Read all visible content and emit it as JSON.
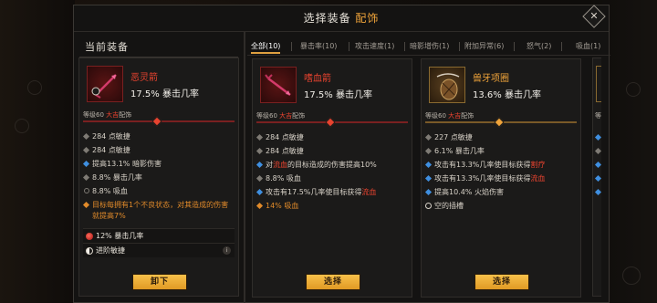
{
  "title": {
    "prefix": "选择装备 ",
    "accent": "配饰"
  },
  "current_column": {
    "title": "当前装备"
  },
  "tabs": [
    {
      "label": "全部(10)",
      "active": true
    },
    {
      "label": "暴击率(10)",
      "active": false
    },
    {
      "label": "攻击速度(1)",
      "active": false
    },
    {
      "label": "暗影增伤(1)",
      "active": false
    },
    {
      "label": "附加异常(6)",
      "active": false
    },
    {
      "label": "怒气(2)",
      "active": false
    },
    {
      "label": "吸血(1)",
      "active": false
    }
  ],
  "current_item": {
    "name": "恶灵箭",
    "main_stat": "17.5% 暴击几率",
    "level_prefix": "等级60 ",
    "quality": "大吉",
    "slot": "配饰",
    "stats": [
      {
        "text": "284 点敏捷"
      },
      {
        "text": "284 点敏捷"
      },
      {
        "text": "提高13.1% 暗影伤害"
      },
      {
        "text": "8.8% 暴击几率"
      },
      {
        "text": "8.8% 吸血"
      },
      {
        "text": "目标每拥有1个不良状态，对其造成的伤害就提高7%"
      }
    ],
    "gem": "12% 暴击几率",
    "advanced": "进阶敏捷",
    "info": "i",
    "button": "卸下"
  },
  "cards": [
    {
      "name": "嗜血箭",
      "main_stat": "17.5% 暴击几率",
      "level_prefix": "等级60 ",
      "quality": "大吉",
      "slot": "配饰",
      "stats": [
        {
          "text": "284 点敏捷"
        },
        {
          "text": "284 点敏捷"
        },
        {
          "pre": "对",
          "hl": "流血",
          "post": "的目标造成的伤害提高10%"
        },
        {
          "text": "8.8% 吸血"
        },
        {
          "pre": "攻击有17.5%几率使目标获得",
          "hl": "流血",
          "post": ""
        },
        {
          "text": "14% 吸血"
        }
      ],
      "button": "选择"
    },
    {
      "name": "兽牙项圈",
      "main_stat": "13.6% 暴击几率",
      "level_prefix": "等级60 ",
      "quality": "大吉",
      "slot": "配饰",
      "stats": [
        {
          "text": "227 点敏捷"
        },
        {
          "text": "6.1% 暴击几率"
        },
        {
          "pre": "攻击有13.3%几率使目标获得",
          "hl": "割疗",
          "post": ""
        },
        {
          "pre": "攻击有13.3%几率使目标获得",
          "hl": "流血",
          "post": ""
        },
        {
          "text": "提高10.4% 火焰伤害"
        },
        {
          "text": "空的插槽"
        }
      ],
      "button": "选择"
    }
  ],
  "peek_card": {
    "level_fragment": "等"
  },
  "colors": {
    "accent_gold": "#f0a43a",
    "quality_red": "#e8432f",
    "button_yellow": "#f2b23a",
    "bullet_blue": "#3f8fe0",
    "bullet_orange": "#e08a2a"
  }
}
